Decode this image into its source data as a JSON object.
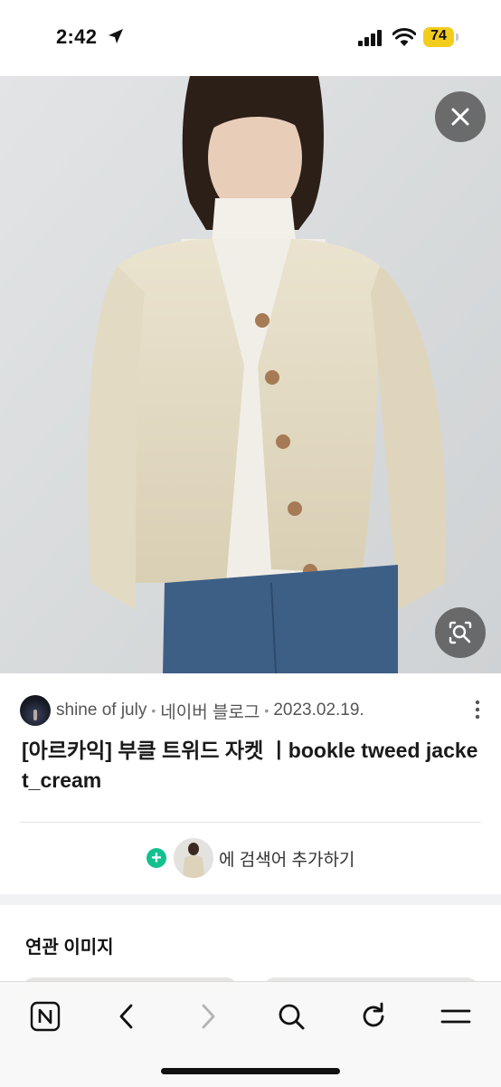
{
  "status_bar": {
    "time": "2:42",
    "battery": "74"
  },
  "hero": {
    "close_icon": "close-icon",
    "lens_icon": "image-search-icon"
  },
  "result": {
    "author": "shine of july",
    "platform": "네이버 블로그",
    "date": "2023.02.19.",
    "separator": "•",
    "title": "[아르카익] 부클 트위드 자켓 ㅣbookle tweed jacket_cream",
    "add_search_label": "에 검색어 추가하기"
  },
  "related": {
    "title": "연관 이미지"
  },
  "toolbar": {
    "items": [
      "naver-home-icon",
      "back-icon",
      "forward-icon",
      "search-icon",
      "reload-icon",
      "menu-icon"
    ]
  },
  "colors": {
    "accent_green": "#12c18f",
    "battery_yellow": "#f2cd1c"
  }
}
